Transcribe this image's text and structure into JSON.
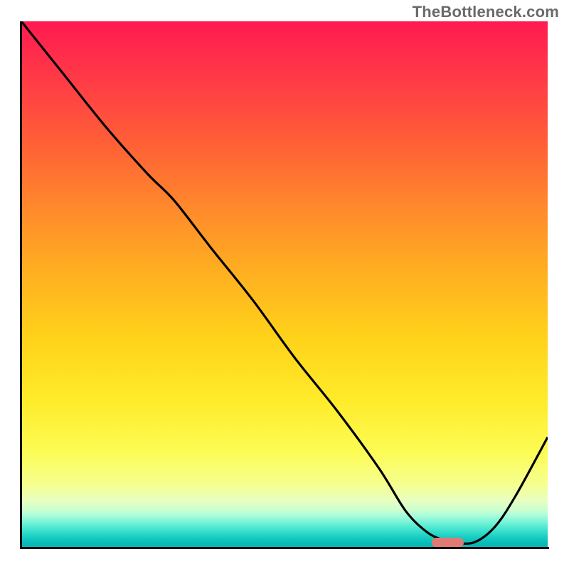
{
  "watermark": "TheBottleneck.com",
  "colors": {
    "curve": "#000000",
    "marker": "#e07a75"
  },
  "chart_data": {
    "type": "line",
    "title": "",
    "xlabel": "",
    "ylabel": "",
    "xlim": [
      0,
      100
    ],
    "ylim": [
      0,
      100
    ],
    "grid": false,
    "legend": false,
    "series": [
      {
        "name": "bottleneck-curve",
        "x": [
          0,
          8,
          16,
          24,
          29,
          36,
          44,
          52,
          60,
          68,
          73,
          77,
          80,
          82,
          86,
          90,
          94,
          100
        ],
        "y": [
          100,
          90,
          80,
          71,
          66,
          57,
          47,
          36,
          26,
          15,
          7,
          3,
          1.5,
          1,
          1,
          4,
          10,
          21
        ]
      }
    ],
    "marker": {
      "x_start": 78,
      "x_end": 84,
      "y": 1
    },
    "gradient_stops": [
      {
        "pos": 0,
        "color": "#ff1a50"
      },
      {
        "pos": 50,
        "color": "#ffd21a"
      },
      {
        "pos": 90,
        "color": "#f6ff90"
      },
      {
        "pos": 100,
        "color": "#07b2b4"
      }
    ]
  }
}
